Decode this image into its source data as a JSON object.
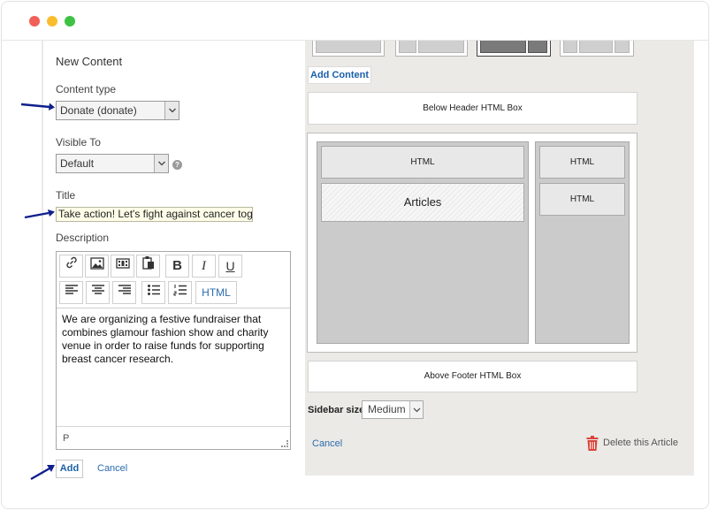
{
  "window": {
    "controls": [
      "close",
      "minimize",
      "maximize"
    ]
  },
  "form": {
    "title": "New Content",
    "content_type_label": "Content type",
    "content_type_value": "Donate (donate)",
    "visible_to_label": "Visible To",
    "visible_to_value": "Default",
    "help_glyph": "?",
    "title_label": "Title",
    "title_value": "Take action! Let's fight against cancer toge",
    "description_label": "Description",
    "toolbar": {
      "row1": [
        "link-icon",
        "image-icon",
        "video-icon",
        "paste-icon",
        "bold-icon",
        "italic-icon",
        "underline-icon"
      ],
      "row2": [
        "align-left-icon",
        "align-center-icon",
        "align-right-icon",
        "bullet-list-icon",
        "numbered-list-icon"
      ],
      "bold_glyph": "B",
      "italic_glyph": "I",
      "underline_glyph": "U",
      "html_button": "HTML"
    },
    "description_text": "We are organizing a festive fundraiser that combines glamour fashion show and charity venue in order to raise funds for supporting breast cancer research.",
    "editor_status": "P",
    "add_button": "Add",
    "cancel_link": "Cancel"
  },
  "layout": {
    "add_content": "Add Content",
    "below_header": "Below Header HTML Box",
    "main_widgets": {
      "html": "HTML",
      "articles": "Articles"
    },
    "sidebar_widgets": [
      "HTML",
      "HTML"
    ],
    "above_footer": "Above Footer HTML Box",
    "sidebar_size_label": "Sidebar size:",
    "sidebar_size_value": "Medium",
    "cancel_link": "Cancel",
    "delete_article": "Delete this Article"
  },
  "colors": {
    "link": "#2b6bb0",
    "annotation_arrow": "#0f1f8c",
    "delete_icon": "#d9453a"
  }
}
